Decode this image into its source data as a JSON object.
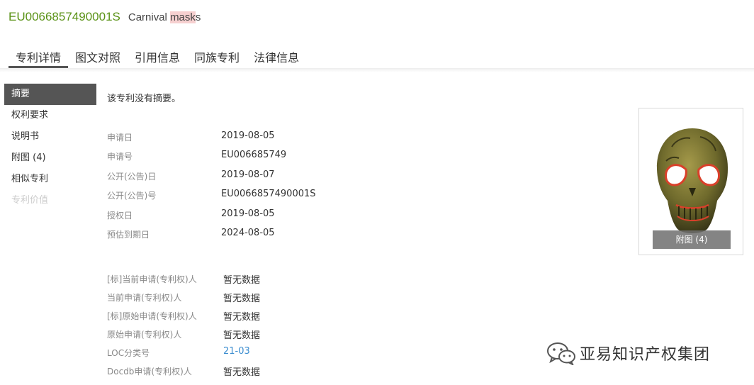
{
  "header": {
    "publication_number": "EU0066857490001S",
    "title_prefix": "Carnival ",
    "title_highlight": "mask",
    "title_suffix": "s"
  },
  "tabs": [
    {
      "label": "专利详情",
      "active": true
    },
    {
      "label": "图文对照",
      "active": false
    },
    {
      "label": "引用信息",
      "active": false
    },
    {
      "label": "同族专利",
      "active": false
    },
    {
      "label": "法律信息",
      "active": false
    }
  ],
  "sidebar": {
    "items": [
      {
        "label": "摘要",
        "active": true
      },
      {
        "label": "权利要求"
      },
      {
        "label": "说明书"
      },
      {
        "label": "附图 (4)"
      },
      {
        "label": "相似专利"
      },
      {
        "label": "专利价值",
        "disabled": true
      }
    ]
  },
  "abstract_text": "该专利没有摘要。",
  "bibliographic": [
    {
      "label": "申请日",
      "value": "2019-08-05"
    },
    {
      "label": "申请号",
      "value": "EU006685749"
    },
    {
      "label": "公开(公告)日",
      "value": "2019-08-07"
    },
    {
      "label": "公开(公告)号",
      "value": "EU0066857490001S"
    },
    {
      "label": "授权日",
      "value": "2019-08-05"
    },
    {
      "label": "预估到期日",
      "value": "2024-08-05"
    }
  ],
  "parties": [
    {
      "label": "[标]当前申请(专利权)人",
      "value": "暂无数据"
    },
    {
      "label": "当前申请(专利权)人",
      "value": "暂无数据"
    },
    {
      "label": "[标]原始申请(专利权)人",
      "value": "暂无数据"
    },
    {
      "label": "原始申请(专利权)人",
      "value": "暂无数据"
    },
    {
      "label": "LOC分类号",
      "value": "21-03",
      "link": true
    },
    {
      "label": "Docdb申请(专利权)人",
      "value": "暂无数据"
    }
  ],
  "figure": {
    "caption": "附图 (4)",
    "image_subject": "skull-mask-image"
  },
  "watermark": {
    "text": "亚易知识产权集团",
    "icon": "wechat-icon"
  },
  "colors": {
    "publication_number": "#5a9216",
    "highlight": "#f6d0d0",
    "active_nav": "#555555",
    "link": "#3a8ccf"
  }
}
